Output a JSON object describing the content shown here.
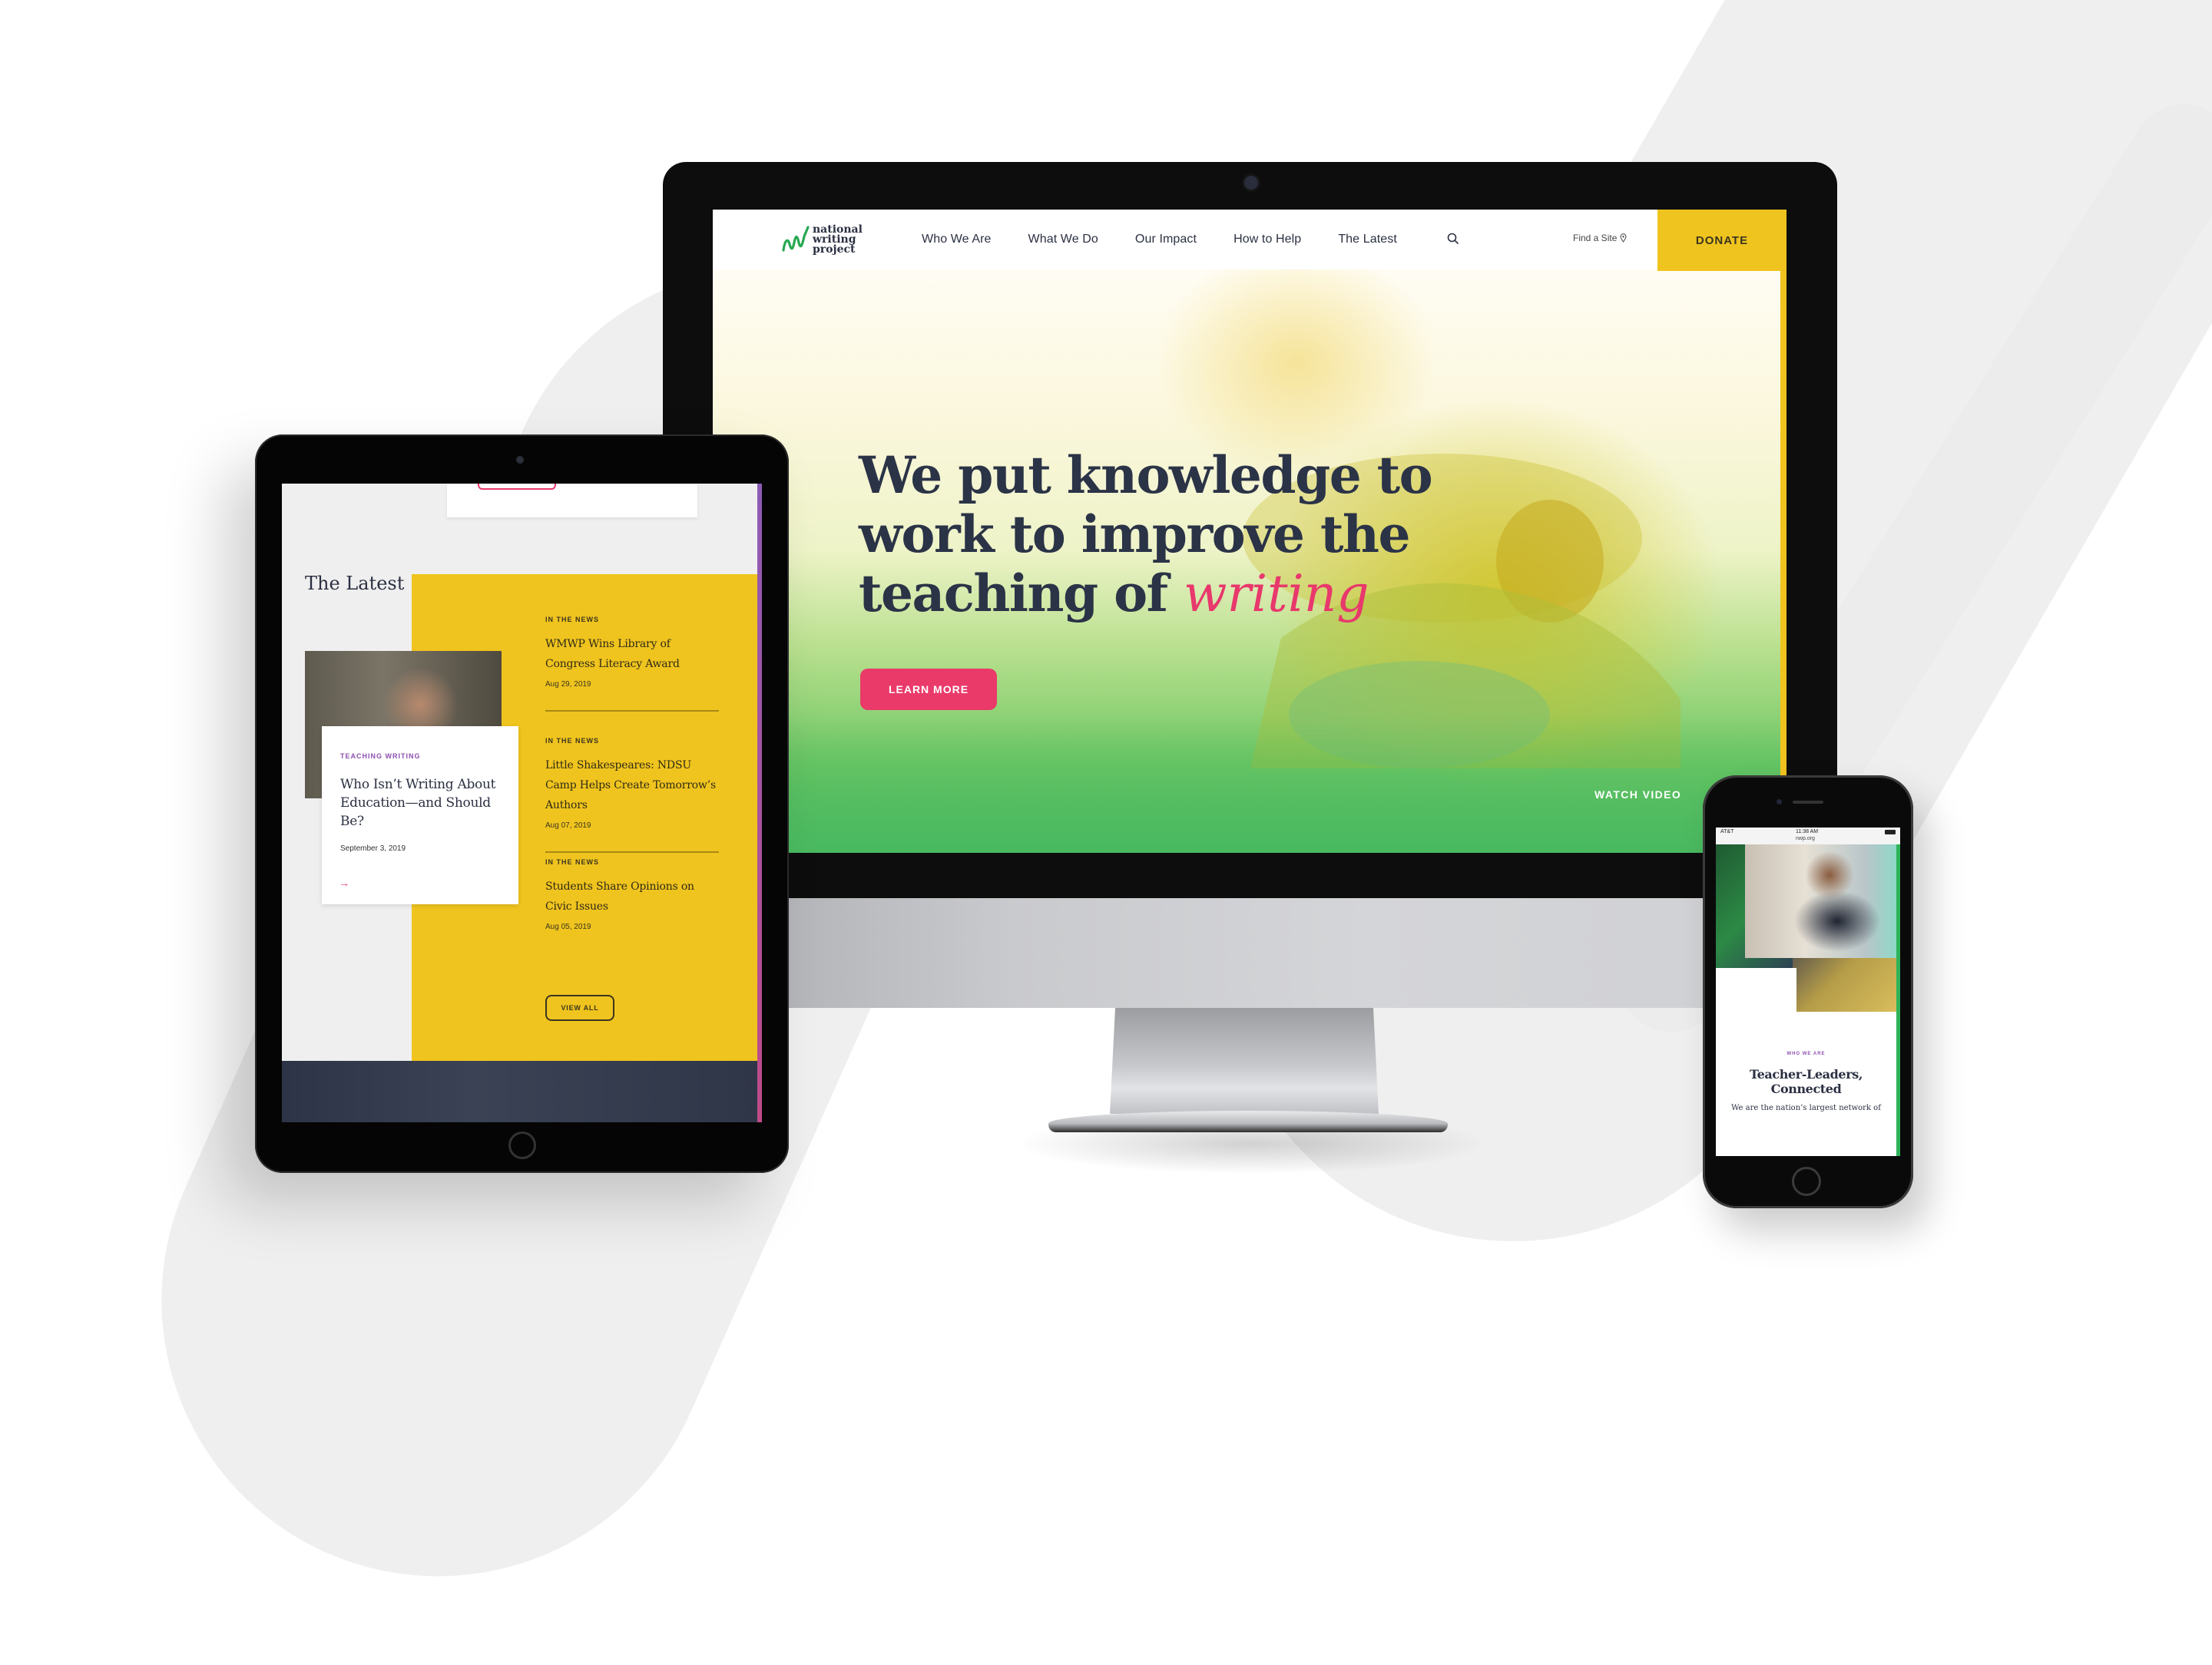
{
  "colors": {
    "brand_yellow": "#f0c41e",
    "brand_pink": "#ea3a6a",
    "brand_green": "#2fb35a",
    "brand_purple": "#8d4fb0",
    "ink": "#2b3042"
  },
  "desktop": {
    "logo": {
      "line1": "national",
      "line2": "writing",
      "line3": "project",
      "icon": "nwp-squiggle-logo"
    },
    "nav": {
      "items": [
        {
          "label": "Who We Are"
        },
        {
          "label": "What We Do"
        },
        {
          "label": "Our Impact"
        },
        {
          "label": "How to Help"
        },
        {
          "label": "The Latest"
        }
      ],
      "search_icon": "search-icon",
      "find_site": "Find a Site",
      "find_site_icon": "map-pin-icon",
      "donate": "DONATE"
    },
    "hero": {
      "headline_line1": "We put knowledge to",
      "headline_line2": "work to improve the",
      "headline_line3": "teaching of ",
      "headline_accent": "writing",
      "cta": "LEARN MORE",
      "watch_video": "WATCH VIDEO"
    }
  },
  "tablet": {
    "section_title": "The Latest",
    "feature": {
      "category": "TEACHING WRITING",
      "title": "Who Isn’t Writing About Education—and Should Be?",
      "date": "September 3, 2019",
      "arrow_icon": "arrow-right-icon"
    },
    "news": [
      {
        "tag": "IN THE NEWS",
        "title": "WMWP Wins Library of Congress Literacy Award",
        "date": "Aug 29, 2019"
      },
      {
        "tag": "IN THE NEWS",
        "title": "Little Shakespeares: NDSU Camp Helps Create Tomorrow’s Authors",
        "date": "Aug 07, 2019"
      },
      {
        "tag": "IN THE NEWS",
        "title": "Students Share Opinions on Civic Issues",
        "date": "Aug 05, 2019"
      }
    ],
    "view_all": "VIEW ALL"
  },
  "phone": {
    "status": {
      "carrier": "AT&T",
      "time": "11:38 AM",
      "url": "nwp.org"
    },
    "eyebrow": "WHO WE ARE",
    "title_line1": "Teacher-Leaders,",
    "title_line2": "Connected",
    "body": "We are the nation’s largest network of"
  }
}
